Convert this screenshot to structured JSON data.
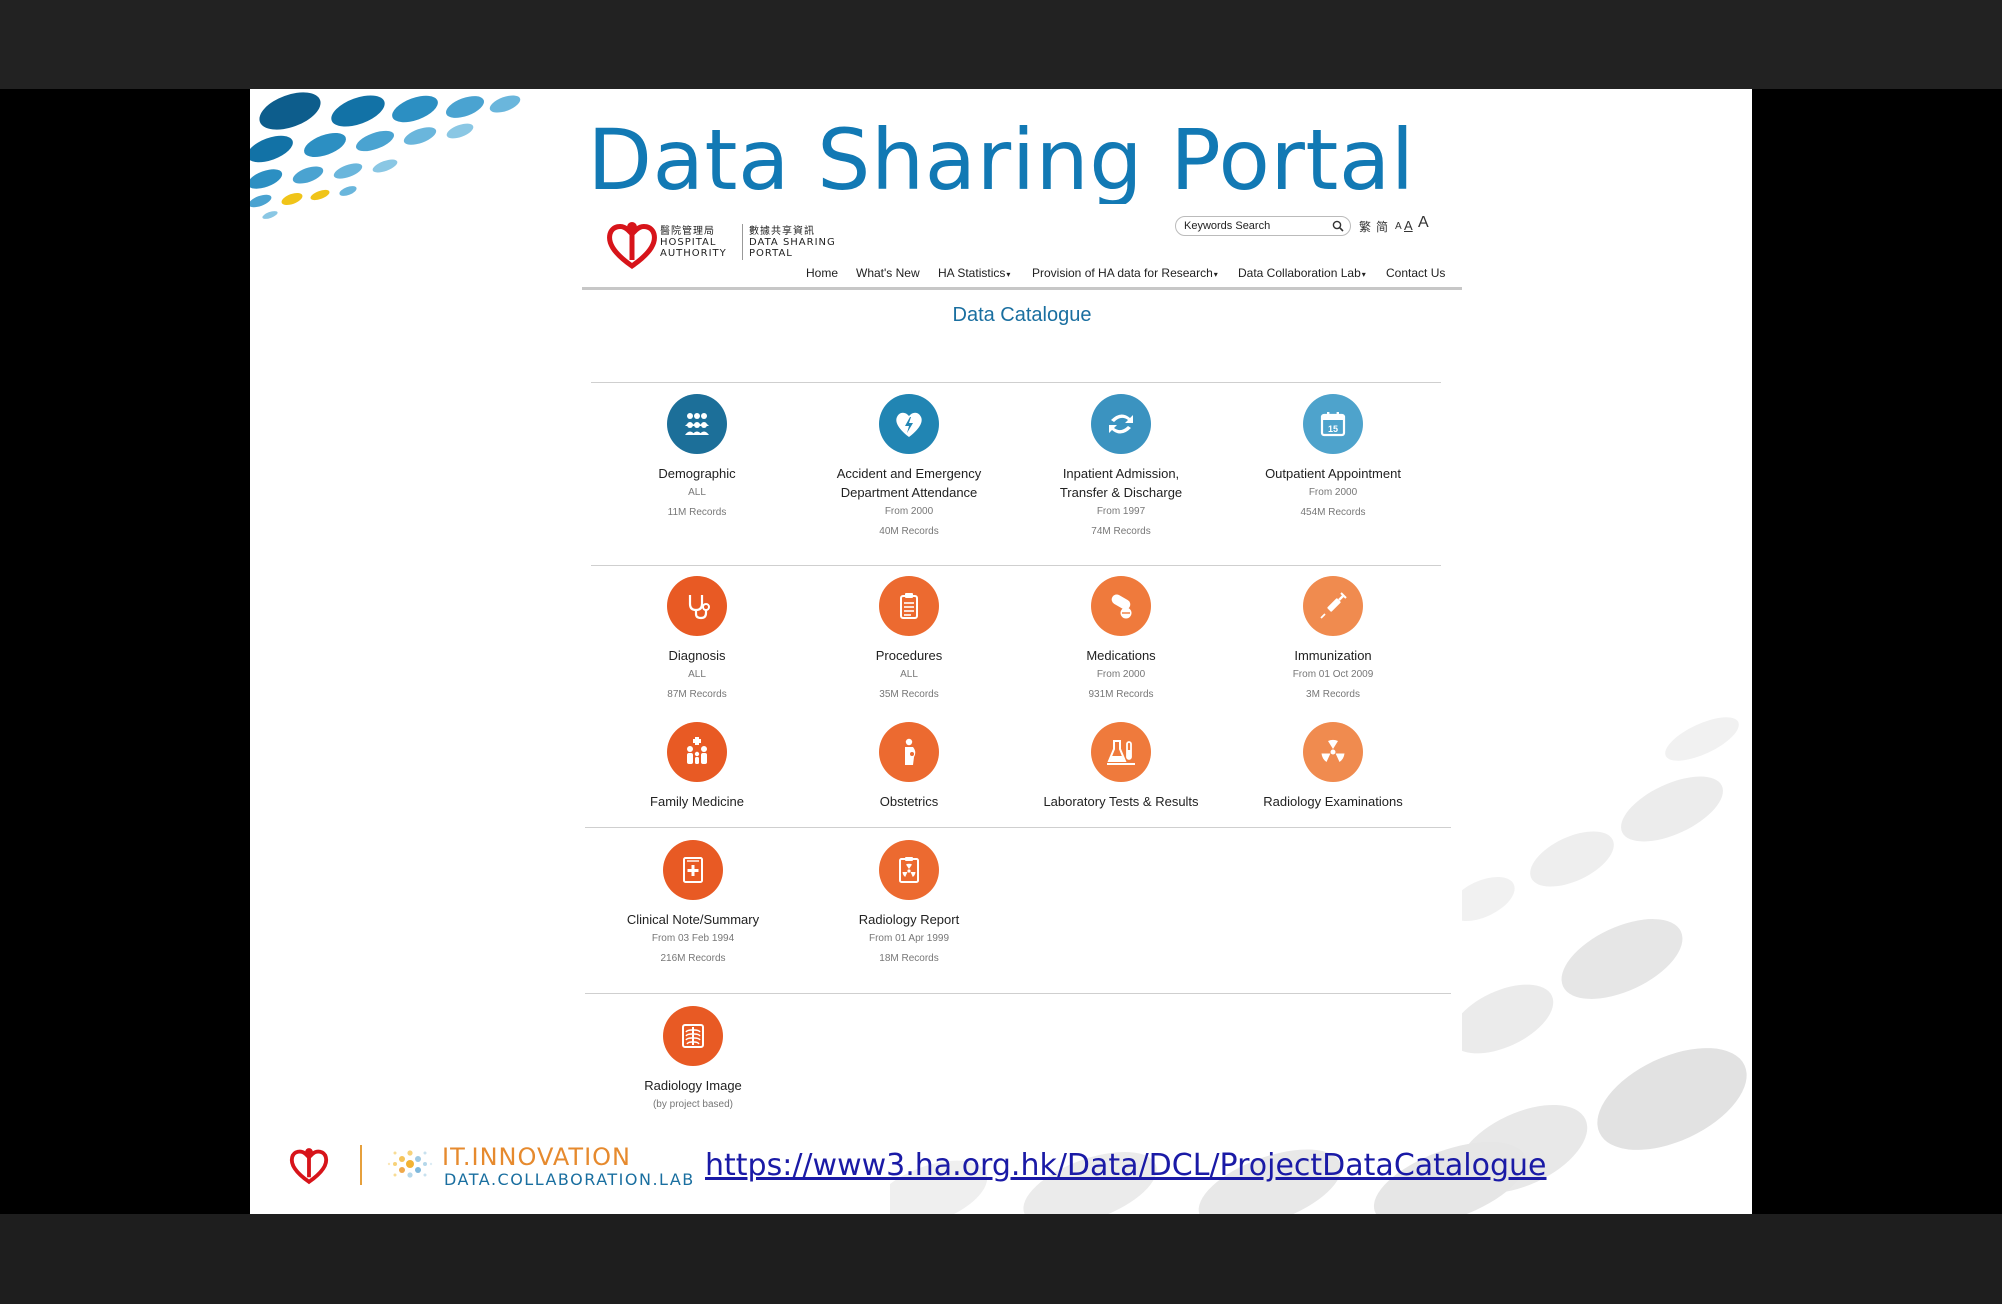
{
  "slide": {
    "title": "Data Sharing Portal",
    "footer_url": "https://www3.ha.org.hk/Data/DCL/ProjectDataCatalogue",
    "footer_brand_line1": "IT.INNOVATION",
    "footer_brand_line2": "DATA.COLLABORATION.LAB"
  },
  "portal": {
    "header": {
      "ha_name_zh": "醫院管理局",
      "ha_name_en_1": "HOSPITAL",
      "ha_name_en_2": "AUTHORITY",
      "portal_name_zh": "數據共享資訊",
      "portal_name_en_1": "DATA SHARING",
      "portal_name_en_2": "PORTAL",
      "search_placeholder": "Keywords Search",
      "lang_trad": "繁",
      "lang_simp": "简",
      "font_small": "A",
      "font_medium": "A",
      "font_large": "A"
    },
    "nav": {
      "home": "Home",
      "whats_new": "What's New",
      "ha_statistics": "HA Statistics",
      "provision": "Provision of HA data for Research",
      "dcl": "Data Collaboration Lab",
      "contact": "Contact Us"
    },
    "catalogue_title": "Data Catalogue",
    "tiles": [
      {
        "name": "Demographic",
        "line1": "ALL",
        "line2": "11M Records",
        "color": "#1c6f99",
        "icon": "people-group-icon"
      },
      {
        "name": "Accident and Emergency",
        "name2": "Department Attendance",
        "line1": "From 2000",
        "line2": "40M Records",
        "color": "#2185b3",
        "icon": "heart-bolt-icon"
      },
      {
        "name": "Inpatient Admission,",
        "name2": "Transfer & Discharge",
        "line1": "From 1997",
        "line2": "74M Records",
        "color": "#3b93c0",
        "icon": "transfer-arrows-icon"
      },
      {
        "name": "Outpatient Appointment",
        "line1": "From 2000",
        "line2": "454M Records",
        "color": "#4ea3cc",
        "icon": "calendar-icon",
        "calendar_day": "15"
      },
      {
        "name": "Diagnosis",
        "line1": "ALL",
        "line2": "87M Records",
        "color": "#e85a24",
        "icon": "stethoscope-icon"
      },
      {
        "name": "Procedures",
        "line1": "ALL",
        "line2": "35M Records",
        "color": "#ec6a30",
        "icon": "clipboard-icon"
      },
      {
        "name": "Medications",
        "line1": "From 2000",
        "line2": "931M Records",
        "color": "#ef7a3c",
        "icon": "pills-icon"
      },
      {
        "name": "Immunization",
        "line1": "From 01 Oct 2009",
        "line2": "3M Records",
        "color": "#f08b4f",
        "icon": "syringe-icon"
      },
      {
        "name": "Family Medicine",
        "color": "#e85a24",
        "icon": "family-icon"
      },
      {
        "name": "Obstetrics",
        "color": "#ec6a30",
        "icon": "pregnant-icon"
      },
      {
        "name": "Laboratory Tests & Results",
        "color": "#ef7a3c",
        "icon": "lab-flask-icon"
      },
      {
        "name": "Radiology Examinations",
        "color": "#f08b4f",
        "icon": "radiation-icon"
      },
      {
        "name": "Clinical Note/Summary",
        "line1": "From 03 Feb 1994",
        "line2": "216M Records",
        "color": "#e85a24",
        "icon": "medical-note-icon"
      },
      {
        "name": "Radiology Report",
        "line1": "From 01 Apr 1999",
        "line2": "18M Records",
        "color": "#ec6a30",
        "icon": "radiology-report-icon"
      },
      {
        "name": "Radiology Image",
        "line1": "(by project based)",
        "color": "#e85a24",
        "icon": "xray-icon"
      }
    ]
  }
}
